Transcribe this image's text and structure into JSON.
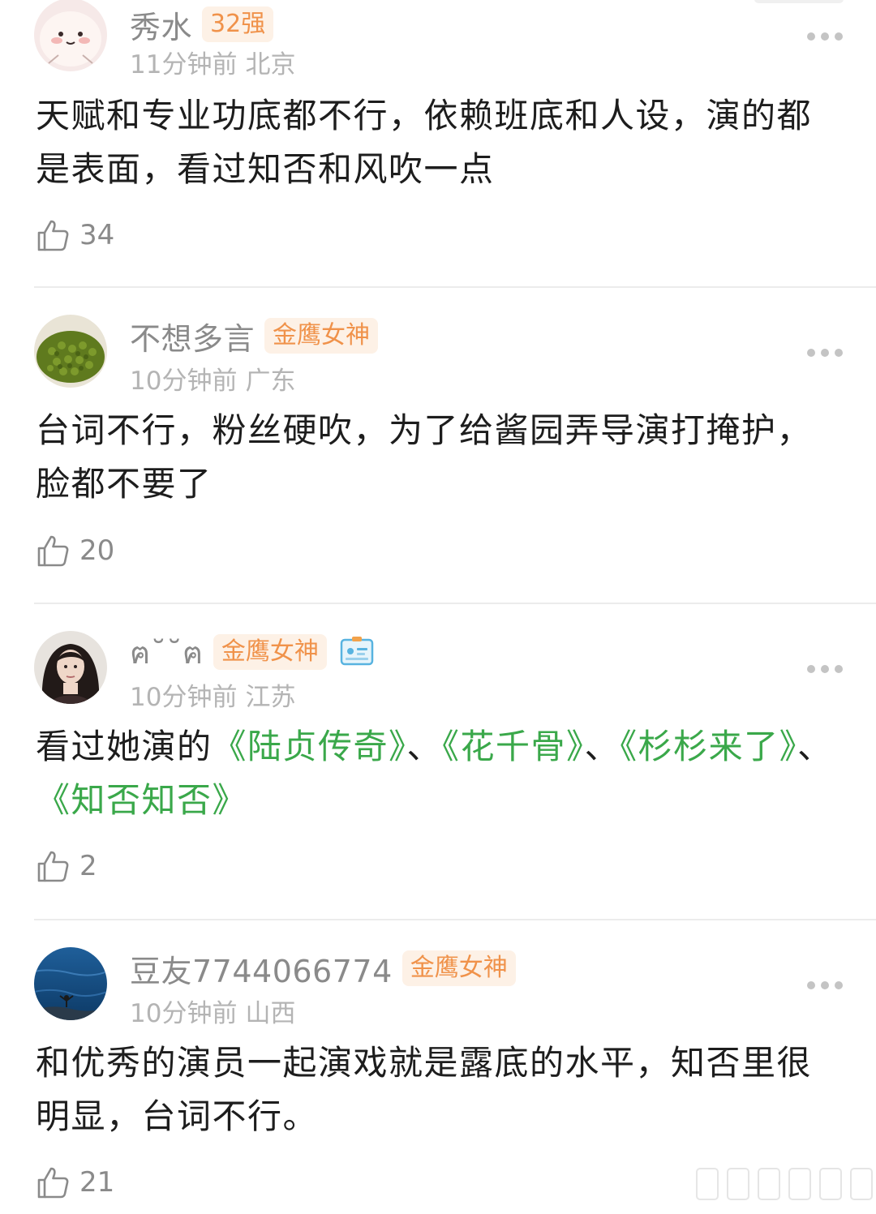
{
  "comments": [
    {
      "username": "秀水",
      "badge": "32强",
      "time": "11分钟前",
      "location": "北京",
      "text": "天赋和专业功底都不行，依赖班底和人设，演的都是表面，看过知否和风吹一点",
      "likes": "34",
      "avatar_icon": "cartoon-face-avatar"
    },
    {
      "username": "不想多言",
      "badge": "金鹰女神",
      "time": "10分钟前",
      "location": "广东",
      "text": "台词不行，粉丝硬吹，为了给酱园弄导演打掩护，脸都不要了",
      "likes": "20",
      "avatar_icon": "mung-beans-avatar"
    },
    {
      "username": "ฅ˘˘ฅ",
      "badge": "金鹰女神",
      "time": "10分钟前",
      "location": "江苏",
      "text_parts": [
        {
          "t": "看过她演的",
          "link": false
        },
        {
          "t": "《陆贞传奇》",
          "link": true
        },
        {
          "t": "、",
          "link": false
        },
        {
          "t": "《花千骨》",
          "link": true
        },
        {
          "t": "、",
          "link": false
        },
        {
          "t": "《杉杉来了》",
          "link": true
        },
        {
          "t": "、",
          "link": false
        },
        {
          "t": "《知否知否》",
          "link": true
        }
      ],
      "likes": "2",
      "avatar_icon": "portrait-photo-avatar",
      "extra_icon": "id-card-icon"
    },
    {
      "username": "豆友7744066774",
      "badge": "金鹰女神",
      "time": "10分钟前",
      "location": "山西",
      "text": "和优秀的演员一起演戏就是露底的水平，知否里很明显，台词不行。",
      "likes": "21",
      "avatar_icon": "ocean-swimmer-avatar"
    }
  ],
  "colors": {
    "username": "#8a8a8a",
    "badge_text": "#f0924a",
    "badge_bg": "#fdf1e6",
    "meta": "#b4b4b4",
    "body_text": "#1d1d1d",
    "link": "#3aa84a",
    "divider": "#ececec"
  }
}
